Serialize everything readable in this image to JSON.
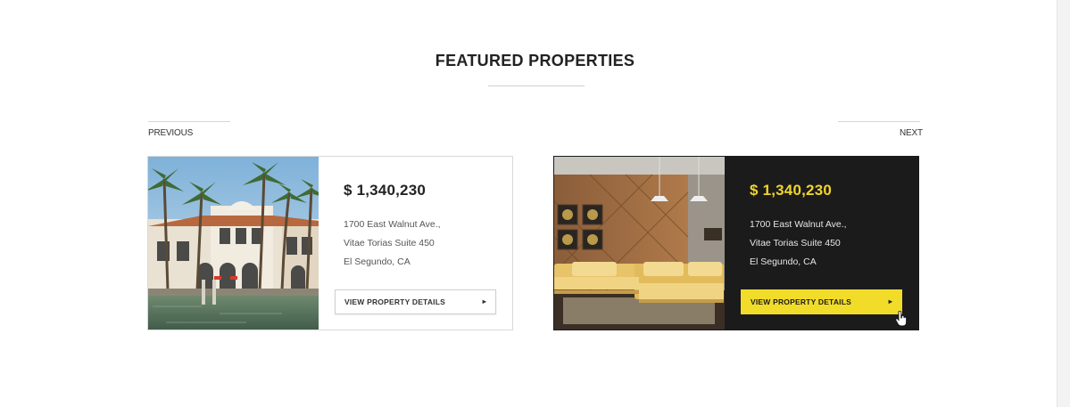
{
  "section": {
    "title": "FEATURED PROPERTIES"
  },
  "navigation": {
    "previous_label": "PREVIOUS",
    "next_label": "NEXT"
  },
  "properties": [
    {
      "price": "$ 1,340,230",
      "address_line1": "1700 East Walnut Ave.,",
      "address_line2": "Vitae Torias Suite 450",
      "address_line3": "El Segundo, CA",
      "button_label": "VIEW PROPERTY DETAILS",
      "theme": "light",
      "image": "villa-waterfront-photo"
    },
    {
      "price": "$ 1,340,230",
      "address_line1": "1700 East Walnut Ave.,",
      "address_line2": "Vitae Torias Suite 450",
      "address_line3": "El Segundo, CA",
      "button_label": "VIEW PROPERTY DETAILS",
      "theme": "dark",
      "image": "living-room-interior-photo"
    }
  ],
  "icons": {
    "button_arrow": "chevron-right-icon",
    "pointer": "hand-pointer-icon"
  },
  "colors": {
    "accent_yellow": "#f2dc2a",
    "price_yellow": "#f0d42e",
    "dark_card": "#1b1b1b",
    "border_light": "#d9d9d9"
  }
}
